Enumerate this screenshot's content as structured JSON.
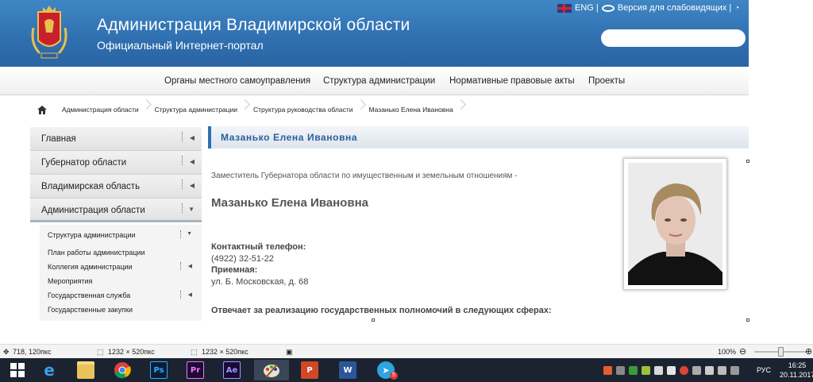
{
  "header": {
    "title": "Администрация Владимирской области",
    "subtitle": "Официальный Интернет-портал",
    "lang_link": "ENG |",
    "accessibility_link": "Версия для слабовидящих |",
    "search_placeholder": ""
  },
  "nav": {
    "items": [
      "Органы местного самоуправления",
      "Структура администрации",
      "Нормативные правовые акты",
      "Проекты"
    ]
  },
  "breadcrumb": [
    "Администрация области",
    "Структура администрации",
    "Структура руководства области",
    "Мазанько Елена Ивановна"
  ],
  "sidebar": {
    "items": [
      "Главная",
      "Губернатор области",
      "Владимирская область",
      "Администрация области"
    ],
    "submenu": [
      "Структура администрации",
      "План работы администрации",
      "Коллегия администрации",
      "Мероприятия",
      "Государственная служба",
      "Государственные закупки"
    ]
  },
  "content": {
    "heading": "Мазанько Елена Ивановна",
    "position": "Заместитель Губернатора области по имущественным и земельным отношениям -",
    "name": "Мазанько Елена Ивановна",
    "phone_label": "Контактный телефон:",
    "phone": "(4922) 32-51-22",
    "reception_label": "Приемная:",
    "address": "ул. Б. Московская, д. 68",
    "responsibilities": "Отвечает за реализацию государственных полномочий в следующих сферах:"
  },
  "statusbar": {
    "cursor": "718, 120пкс",
    "selection": "1232 × 520пкс",
    "image_size": "1232 × 520пкс",
    "zoom": "100%"
  },
  "taskbar": {
    "apps": [
      "internet-explorer",
      "file-explorer",
      "chrome",
      "photoshop",
      "premiere",
      "after-effects",
      "paint",
      "powerpoint",
      "word",
      "telegram"
    ],
    "ps_label": "Ps",
    "pr_label": "Pr",
    "ae_label": "Ae",
    "telegram_badge": "5",
    "language": "РУС",
    "time": "16:25",
    "date": "20.11.2017"
  },
  "colors": {
    "header_blue": "#2f6fb0",
    "accent_text": "#2a5f9a",
    "taskbar": "#1c2330"
  }
}
